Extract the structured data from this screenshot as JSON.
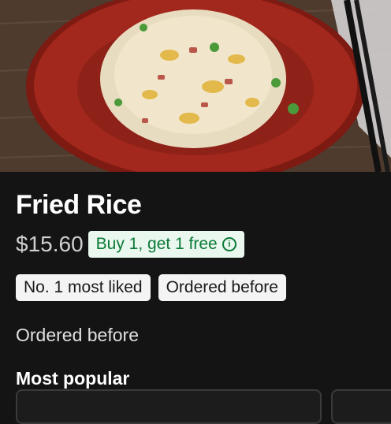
{
  "item": {
    "title": "Fried Rice",
    "price": "$15.60",
    "promo_label": "Buy 1, get 1 free",
    "promo_icon": "info-icon"
  },
  "badges": [
    "No. 1 most liked",
    "Ordered before"
  ],
  "status_text": "Ordered before",
  "section": {
    "title": "Most popular"
  },
  "colors": {
    "background": "#141414",
    "promo_bg": "#e9f7ee",
    "promo_text": "#0b7a36",
    "plate": "#a2271c"
  }
}
